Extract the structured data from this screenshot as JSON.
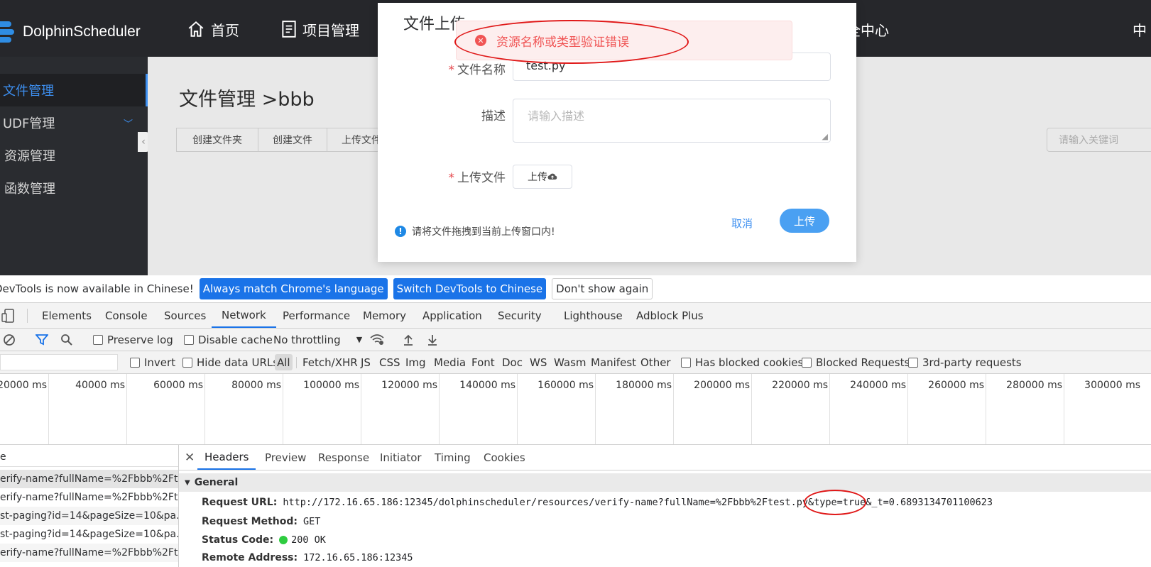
{
  "app": {
    "logo_text": "DolphinScheduler",
    "nav": [
      "首页",
      "项目管理",
      "全中心",
      "中"
    ],
    "sidebar": [
      "文件管理",
      "UDF管理",
      "资源管理",
      "函数管理"
    ],
    "breadcrumb": "文件管理 >bbb",
    "toolbar": [
      "创建文件夹",
      "创建文件",
      "上传文件"
    ],
    "keyword_placeholder": "请输入关键词"
  },
  "modal": {
    "title": "文件上传",
    "error_toast": "资源名称或类型验证错误",
    "file_name_label": "文件名称",
    "file_name_value": "test.py",
    "desc_label": "描述",
    "desc_placeholder": "请输入描述",
    "upload_label": "上传文件",
    "upload_button": "上传",
    "hint": "请将文件拖拽到当前上传窗口内!",
    "cancel": "取消",
    "submit": "上传"
  },
  "devtools": {
    "infobar": {
      "text": "DevTools is now available in Chinese!",
      "btn1": "Always match Chrome's language",
      "btn2": "Switch DevTools to Chinese",
      "btn3": "Don't show again"
    },
    "tabs": [
      "Elements",
      "Console",
      "Sources",
      "Network",
      "Performance",
      "Memory",
      "Application",
      "Security",
      "Lighthouse",
      "Adblock Plus"
    ],
    "active_tab": "Network",
    "toolbar1": {
      "preserve_log": "Preserve log",
      "disable_cache": "Disable cache",
      "throttling": "No throttling"
    },
    "toolbar2": {
      "invert": "Invert",
      "hide_data_urls": "Hide data URLs",
      "types": [
        "All",
        "Fetch/XHR",
        "JS",
        "CSS",
        "Img",
        "Media",
        "Font",
        "Doc",
        "WS",
        "Wasm",
        "Manifest",
        "Other"
      ],
      "has_blocked": "Has blocked cookies",
      "blocked_requests": "Blocked Requests",
      "third_party": "3rd-party requests"
    },
    "timeline_ticks": [
      "20000 ms",
      "40000 ms",
      "60000 ms",
      "80000 ms",
      "100000 ms",
      "120000 ms",
      "140000 ms",
      "160000 ms",
      "180000 ms",
      "200000 ms",
      "220000 ms",
      "240000 ms",
      "260000 ms",
      "280000 ms",
      "300000 ms"
    ],
    "requests_header": "e",
    "requests": [
      "erify-name?fullName=%2Fbbb%2Ft...",
      "erify-name?fullName=%2Fbbb%2Ft...",
      "st-paging?id=14&pageSize=10&pa...",
      "st-paging?id=14&pageSize=10&pa...",
      "erify-name?fullName=%2Fbbb%2Ft..."
    ],
    "detail_tabs": [
      "Headers",
      "Preview",
      "Response",
      "Initiator",
      "Timing",
      "Cookies"
    ],
    "general_label": "General",
    "general": {
      "request_url_label": "Request URL:",
      "request_url": "http://172.16.65.186:12345/dolphinscheduler/resources/verify-name?fullName=%2Fbbb%2Ftest.py&type=true&_t=0.6893134701100623",
      "method_label": "Request Method:",
      "method": "GET",
      "status_label": "Status Code:",
      "status": "200 OK",
      "remote_label": "Remote Address:",
      "remote": "172.16.65.186:12345"
    }
  }
}
